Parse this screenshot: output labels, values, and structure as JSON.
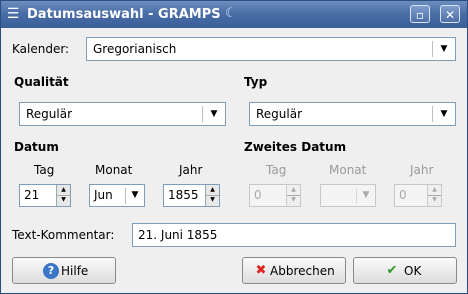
{
  "window": {
    "title": "Datumsauswahl - GRAMPS"
  },
  "calendar": {
    "label": "Kalender:",
    "value": "Gregorianisch"
  },
  "quality": {
    "heading": "Qualität",
    "value": "Regulär"
  },
  "type": {
    "heading": "Typ",
    "value": "Regulär"
  },
  "date": {
    "heading": "Datum",
    "day_label": "Tag",
    "month_label": "Monat",
    "year_label": "Jahr",
    "day": "21",
    "month": "Jun",
    "year": "1855"
  },
  "second_date": {
    "heading": "Zweites Datum",
    "day_label": "Tag",
    "month_label": "Monat",
    "year_label": "Jahr",
    "day": "0",
    "month": "",
    "year": "0"
  },
  "text_comment": {
    "label": "Text-Kommentar:",
    "value": "21. Juni 1855"
  },
  "buttons": {
    "help": "Hilfe",
    "cancel": "Abbrechen",
    "ok": "OK"
  }
}
